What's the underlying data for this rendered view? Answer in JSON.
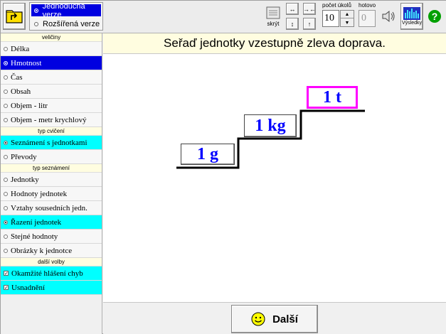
{
  "toolbar": {
    "version_simple": "Jednoduchá verze",
    "version_extended": "Rozšířená verze",
    "hide_label": "skrýt",
    "task_count_label": "počet úkolů",
    "task_count_value": "10",
    "done_label": "hotovo",
    "done_value": "0",
    "results_label": "Výsledky",
    "help_label": "?"
  },
  "sidebar": {
    "quantities_header": "veličiny",
    "quantities": [
      {
        "label": "Délka",
        "selected": false
      },
      {
        "label": "Hmotnost",
        "selected": true
      },
      {
        "label": "Čas",
        "selected": false
      },
      {
        "label": "Obsah",
        "selected": false
      },
      {
        "label": "Objem - litr",
        "selected": false
      },
      {
        "label": "Objem - metr krychlový",
        "selected": false
      }
    ],
    "exercise_header": "typ cvičení",
    "exercise": [
      {
        "label": "Seznámení s jednotkami",
        "selected": true
      },
      {
        "label": "Převody",
        "selected": false
      }
    ],
    "intro_header": "typ seznámení",
    "intro": [
      {
        "label": "Jednotky",
        "selected": false
      },
      {
        "label": "Hodnoty jednotek",
        "selected": false
      },
      {
        "label": "Vztahy sousedních jedn.",
        "selected": false
      },
      {
        "label": "Řazení jednotek",
        "selected": true
      },
      {
        "label": "Stejné hodnoty",
        "selected": false
      },
      {
        "label": "Obrázky k jednotce",
        "selected": false
      }
    ],
    "more_header": "další volby",
    "more": [
      {
        "label": "Okamžité hlášení chyb",
        "checked": true
      },
      {
        "label": "Usnadnění",
        "checked": true
      }
    ]
  },
  "main": {
    "instruction": "Seřaď jednotky vzestupně zleva doprava.",
    "units": [
      "1 g",
      "1 kg",
      "1 t"
    ],
    "next_label": "Další"
  },
  "colors": {
    "selected_blue": "#0000e0",
    "selected_cyan": "#00ffff",
    "unit_text": "#0000ff",
    "active_border": "#ff00ff",
    "instruction_bg": "#fffde0"
  }
}
